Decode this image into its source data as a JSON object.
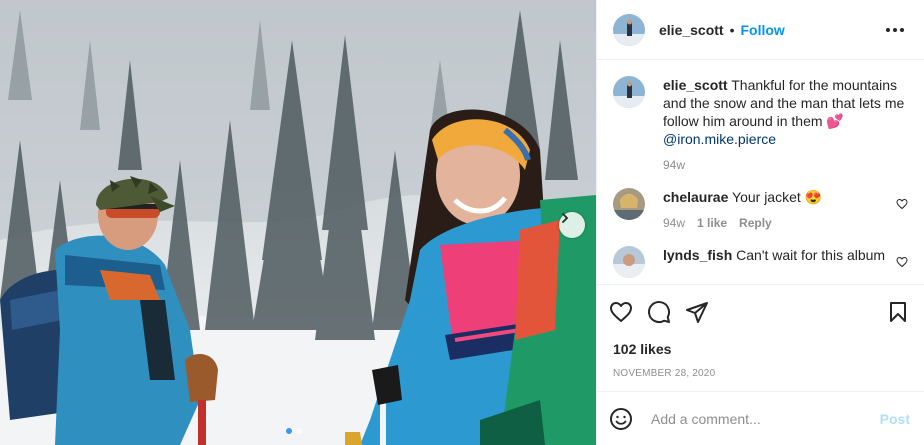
{
  "post": {
    "username": "elie_scott",
    "separator": "•",
    "follow_label": "Follow",
    "caption": {
      "username": "elie_scott",
      "text": "Thankful for the mountains and the snow and the man that lets me follow him around in them",
      "emoji": "💕",
      "mention": "@iron.mike.pierce",
      "age": "94w"
    },
    "comments": [
      {
        "username": "chelaurae",
        "text": "Your jacket",
        "emoji": "😍",
        "age": "94w",
        "likes": "1 like",
        "reply_label": "Reply"
      },
      {
        "username": "lynds_fish",
        "text": "Can't wait for this album"
      }
    ],
    "likes_label": "102 likes",
    "date": "NOVEMBER 28, 2020",
    "add_comment_placeholder": "Add a comment...",
    "post_button_label": "Post",
    "carousel": {
      "total": 2,
      "active_index": 1
    }
  },
  "colors": {
    "accent": "#0095f6",
    "post_disabled": "#b2dffc",
    "secondary_text": "#8e8e8e",
    "mention": "#00376b",
    "carousel_active_dot": "#3897f0"
  },
  "icons": [
    "more-icon",
    "heart-icon",
    "comment-icon",
    "share-icon",
    "save-icon",
    "emoji-icon",
    "chevron-right-icon"
  ]
}
